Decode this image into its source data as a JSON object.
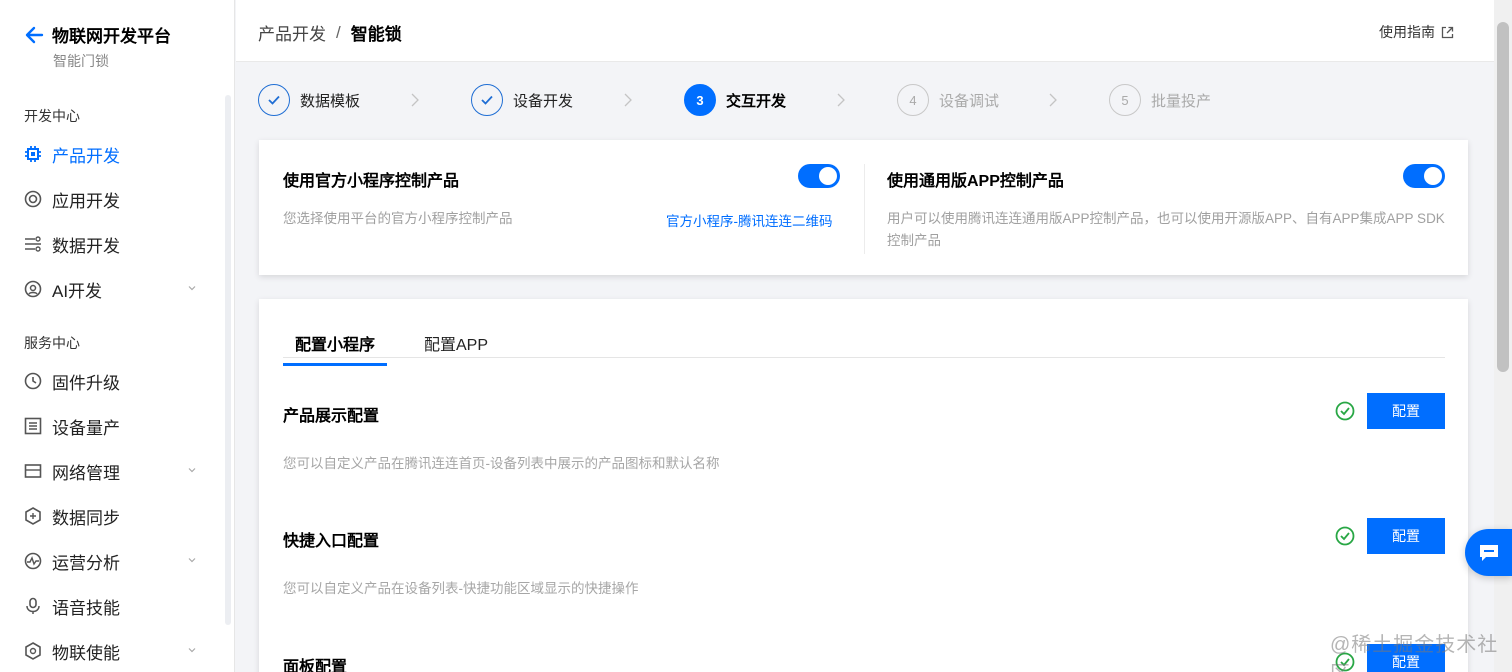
{
  "sidebar": {
    "title": "物联网开发平台",
    "subtitle": "智能门锁",
    "section_dev": "开发中心",
    "dev_items": [
      {
        "label": "产品开发",
        "icon": "chip-icon"
      },
      {
        "label": "应用开发",
        "icon": "app-icon"
      },
      {
        "label": "数据开发",
        "icon": "data-flow-icon"
      },
      {
        "label": "AI开发",
        "icon": "ai-icon"
      }
    ],
    "section_service": "服务中心",
    "service_items": [
      {
        "label": "固件升级",
        "icon": "firmware-icon"
      },
      {
        "label": "设备量产",
        "icon": "list-icon"
      },
      {
        "label": "网络管理",
        "icon": "network-icon"
      },
      {
        "label": "数据同步",
        "icon": "sync-icon"
      },
      {
        "label": "运营分析",
        "icon": "analytics-icon"
      },
      {
        "label": "语音技能",
        "icon": "voice-icon"
      },
      {
        "label": "物联使能",
        "icon": "enable-icon"
      }
    ]
  },
  "header": {
    "breadcrumb_parent": "产品开发",
    "breadcrumb_sep": "/",
    "breadcrumb_current": "智能锁",
    "guide": "使用指南"
  },
  "steps": [
    {
      "num": "",
      "label": "数据模板",
      "state": "done"
    },
    {
      "num": "",
      "label": "设备开发",
      "state": "done"
    },
    {
      "num": "3",
      "label": "交互开发",
      "state": "active"
    },
    {
      "num": "4",
      "label": "设备调试",
      "state": "pending"
    },
    {
      "num": "5",
      "label": "批量投产",
      "state": "pending"
    }
  ],
  "top_card": {
    "left_title": "使用官方小程序控制产品",
    "left_desc": "您选择使用平台的官方小程序控制产品",
    "left_link": "官方小程序-腾讯连连二维码",
    "right_title": "使用通用版APP控制产品",
    "right_desc": "用户可以使用腾讯连连通用版APP控制产品，也可以使用开源版APP、自有APP集成APP SDK控制产品"
  },
  "main_card": {
    "tabs": [
      "配置小程序",
      "配置APP"
    ],
    "configs": [
      {
        "title": "产品展示配置",
        "desc": "您可以自定义产品在腾讯连连首页-设备列表中展示的产品图标和默认名称",
        "button": "配置"
      },
      {
        "title": "快捷入口配置",
        "desc": "您可以自定义产品在设备列表-快捷功能区域显示的快捷操作",
        "button": "配置"
      },
      {
        "title": "面板配置",
        "desc": "",
        "button": "配置"
      }
    ]
  },
  "watermark": "@稀土掘金技术社区",
  "colors": {
    "accent": "#006eff",
    "success": "#29a745"
  }
}
